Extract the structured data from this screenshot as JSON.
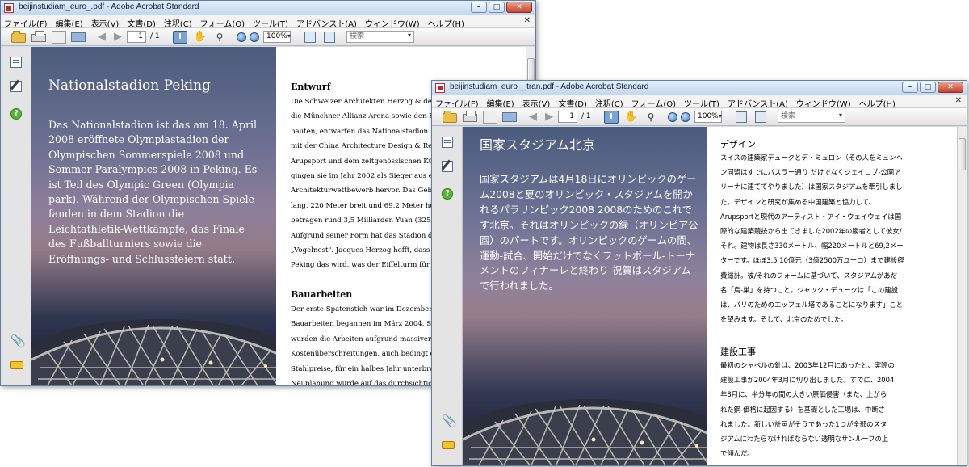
{
  "windows": {
    "de": {
      "title": "beijinstudiam_euro_.pdf - Adobe Acrobat Standard",
      "page_current": "1",
      "page_total": "/ 1",
      "zoom": "100%",
      "search_placeholder": "検索",
      "photo_title": "Nationalstadion Peking",
      "photo_body": "Das Nationalstadion ist das am 18. April 2008 eröffnete Olympiastadion der Olympischen Sommerspiele 2008 und Sommer Paralympics 2008 in Peking. Es ist Teil des Olympic Green (Olympia park). Während der Olympischen Spiele fanden in dem Stadion die Leichtathletik-Wettkämpfe, das Finale des Fußballturniers sowie die Eröffnungs- und Schlussfeiern statt.",
      "section1_heading": "Entwurf",
      "section1_lines": [
        "Die Schweizer Architekten Herzog & de M",
        "die Münchner Allianz Arena sowie den Bas",
        "bauten, entwarfen das Nationalstadion. In Z",
        "mit der China Architecture Design & Resea",
        "Arupsport und dem zeitgenössischen Küns",
        "gingen sie im Jahr 2002 als Sieger aus eine",
        "Architekturwettbewerb hervor. Das Gebäu",
        "lang, 220 Meter breit und 69,2 Meter hoch.",
        "betragen rund 3,5 Milliarden Yuan (325 Mi",
        "Aufgrund seiner Form hat das Stadion den",
        "„Vogelnest\". Jacques Herzog hofft, dass „d",
        "Peking das wird, was der Eiffelturm für Pa"
      ],
      "section2_heading": "Bauarbeiten",
      "section2_lines": [
        "Der erste Spatenstich war im Dezember 20",
        "Bauarbeiten begannen im März 2004. Scho",
        "wurden die Arbeiten aufgrund massiver",
        "Kostenüberschreitungen, auch bedingt durc",
        "Stahlpreise, für ein halbes Jahr unterbroche",
        "Neuplanung wurde auf das durchsichtige S"
      ]
    },
    "jp": {
      "title": "beijinstudiam_euro__tran.pdf - Adobe Acrobat Standard",
      "page_current": "1",
      "page_total": "/ 1",
      "zoom": "100%",
      "search_placeholder": "検索",
      "photo_title": "国家スタジアム北京",
      "photo_body": "国家スタジアムは4月18日にオリンピックのゲーム2008と夏のオリンピック・スタジアムを開かれるパラリンピック2008 2008のためのこれです北京。それはオリンピックの緑（オリンピア公園）のパートです。オリンピックのゲームの間、運動-試合、開始だけでなくフットボール-トーナメントのフィナーレと終わり-祝賀はスタジアムで行われました。",
      "section1_heading": "デザイン",
      "section1_lines": [
        "スイスの建築家デュークとデ・ミュロン（その人をミュンヘ",
        "ン同盟はすでにバスラー通り だけでなくジェイコブ-公園ア",
        "リーナに建ててやりました）は国家スタジアムを牽引しまし",
        "た。デザインと研究が集める中国建築と協力して、",
        "Arupsportと現代のアーティスト・アイ・ウェイウェイは国",
        "際的な建築競技から出てきました2002年の勝者として彼女/",
        "それ。建物は長さ330メートル、幅220メートルと69,2メー",
        "ターです。ほぼ3,5 10億元（3億2500万ユーロ）まで建設経",
        "費総計。彼/それのフォームに基づいて、スタジアムがあだ",
        "名「鳥-巣」を持つこと。ジャック・デュークは「この建設",
        "は、パリのためのエッフェル塔であることになります」こと",
        "を望みます。そして、北京のためでした。"
      ],
      "section2_heading": "建設工事",
      "section2_lines": [
        "最初のシャベルの針は、2003年12月にあったと、実際の",
        "建設工事が2004年3月に切り出しました。すでに、2004",
        "年8月に、半分年の間の大きい原価侵害（また、上がら",
        "れた鋼-価格に起因する）を基礎とした工場は、中断さ",
        "れました。新しい計画がそうであった1つが全部のスタ",
        "ジアムにわたらなければならない透明なサンルーフの上",
        "で傾んだ。"
      ]
    }
  },
  "menus": [
    "ファイル(F)",
    "編集(E)",
    "表示(V)",
    "文書(D)",
    "注釈(C)",
    "フォーム(O)",
    "ツール(T)",
    "アドバンスト(A)",
    "ウィンドウ(W)",
    "ヘルプ(H)"
  ],
  "colors": {
    "titlebar": "#c4d7ee",
    "accent": "#2f68b4",
    "photo_text": "#ffffff"
  }
}
